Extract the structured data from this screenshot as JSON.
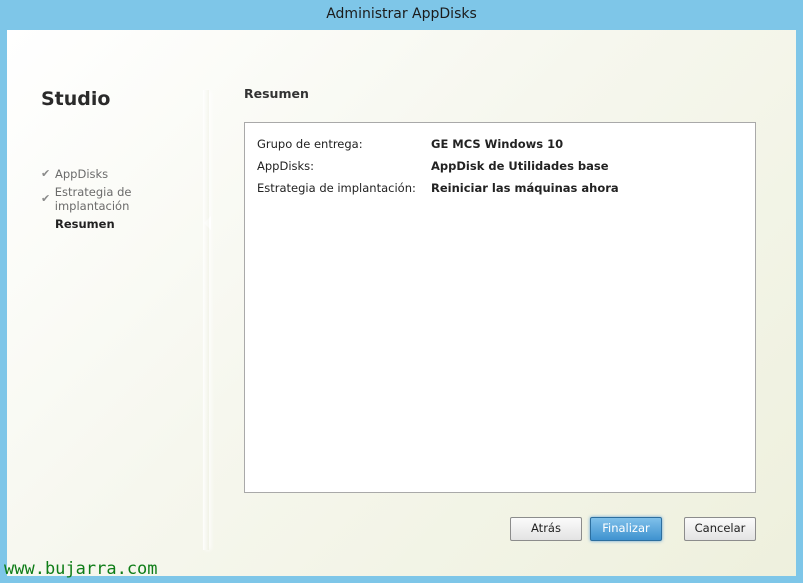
{
  "window": {
    "title": "Administrar AppDisks"
  },
  "sidebar": {
    "heading": "Studio",
    "steps": [
      {
        "label": "AppDisks",
        "done": true
      },
      {
        "label": "Estrategia de implantación",
        "done": true
      },
      {
        "label": "Resumen",
        "done": false,
        "current": true
      }
    ]
  },
  "main": {
    "section_title": "Resumen",
    "summary": [
      {
        "label": "Grupo de entrega:",
        "value": "GE MCS Windows 10"
      },
      {
        "label": "AppDisks:",
        "value": "AppDisk de Utilidades base"
      },
      {
        "label": "Estrategia de implantación:",
        "value": "Reiniciar las máquinas ahora"
      }
    ]
  },
  "buttons": {
    "back": "Atrás",
    "finish": "Finalizar",
    "cancel": "Cancelar"
  },
  "watermark": "www.bujarra.com",
  "colors": {
    "titlebar": "#7ec6e8",
    "primary_button": "#3f92cf",
    "watermark": "#0e7d17"
  }
}
